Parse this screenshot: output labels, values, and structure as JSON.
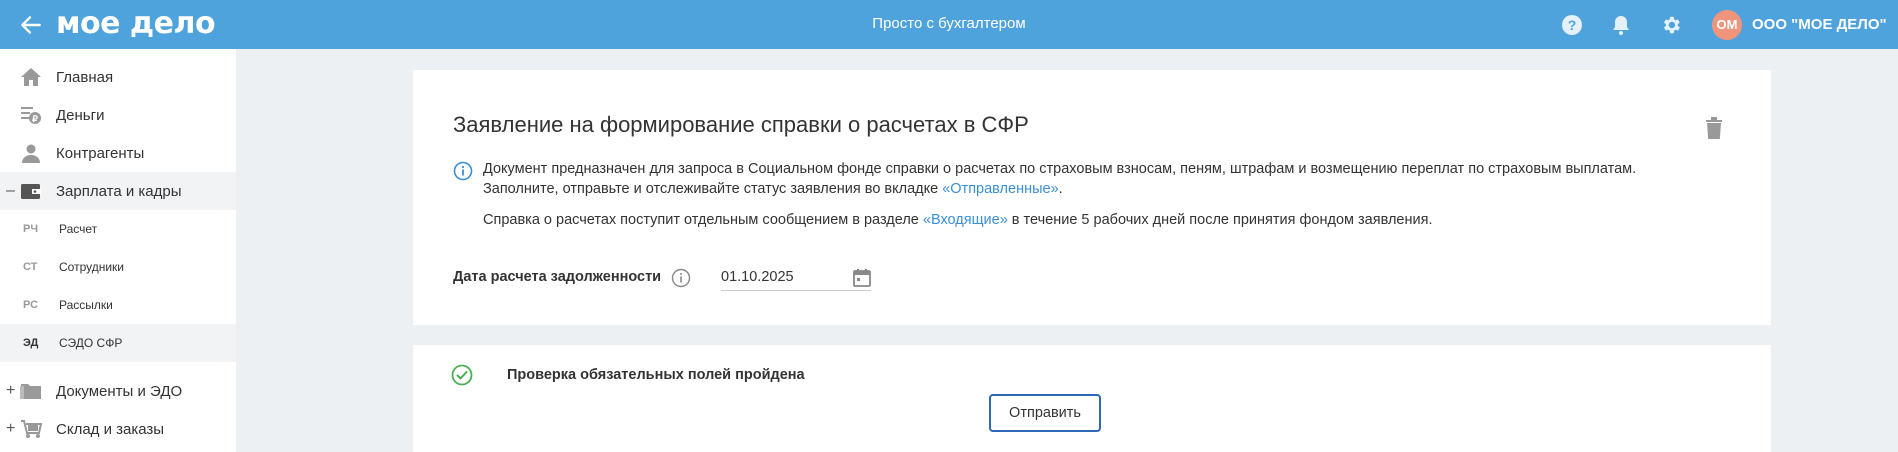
{
  "header": {
    "logo": "мое дело",
    "title": "Просто с бухгалтером",
    "avatar_initials": "ОМ",
    "company": "ООО \"МОЕ ДЕЛО\""
  },
  "sidebar": {
    "items": [
      {
        "label": "Главная",
        "icon": "home-icon"
      },
      {
        "label": "Деньги",
        "icon": "money-icon"
      },
      {
        "label": "Контрагенты",
        "icon": "contractors-icon"
      },
      {
        "label": "Зарплата и кадры",
        "icon": "wallet-icon",
        "prefix": "–"
      },
      {
        "label": "Документы и ЭДО",
        "icon": "folder-icon",
        "prefix": "+"
      },
      {
        "label": "Склад и заказы",
        "icon": "cart-icon",
        "prefix": "+"
      }
    ],
    "subitems": [
      {
        "abbr": "РЧ",
        "label": "Расчет"
      },
      {
        "abbr": "СТ",
        "label": "Сотрудники"
      },
      {
        "abbr": "РС",
        "label": "Рассылки"
      },
      {
        "abbr": "ЭД",
        "label": "СЭДО СФР"
      }
    ]
  },
  "document": {
    "title": "Заявление на формирование справки о расчетах в СФР",
    "info_line1": "Документ предназначен для запроса в Социальном фонде справки о расчетах по страховым взносам, пеням, штрафам и возмещению переплат по страховым выплатам.",
    "info_line2_prefix": "Заполните, отправьте и отслеживайте статус заявления во вкладке ",
    "info_line2_link": "«Отправленные»",
    "info_line2_suffix": ".",
    "info_line3_prefix": "Справка о расчетах поступит отдельным сообщением в разделе ",
    "info_line3_link": "«Входящие»",
    "info_line3_suffix": " в течение 5 рабочих дней после принятия фондом заявления.",
    "field_label": "Дата расчета задолженности",
    "date_value": "01.10.2025"
  },
  "footer": {
    "check_text": "Проверка обязательных полей пройдена",
    "send_label": "Отправить"
  },
  "colors": {
    "header_bg": "#4fa3dc",
    "link": "#3a8fd6",
    "success": "#4caf50",
    "button_border": "#2e69b5",
    "avatar": "#f0957b"
  }
}
